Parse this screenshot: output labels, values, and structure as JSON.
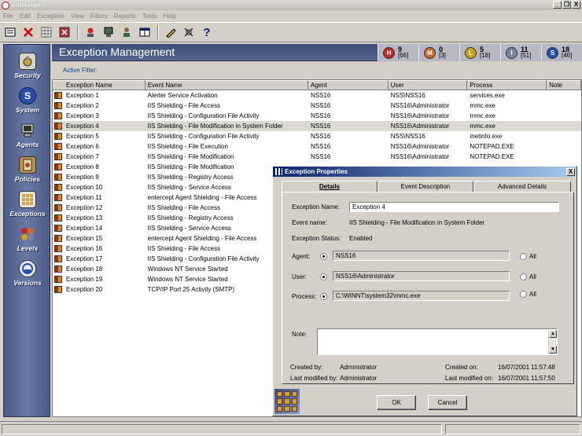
{
  "app": {
    "title": "entercept"
  },
  "menu": [
    "File",
    "Edit",
    "Exception",
    "View",
    "Filters",
    "Reports",
    "Tools",
    "Help"
  ],
  "toolbar": {
    "icons": [
      "properties-icon",
      "delete-icon",
      "grid-icon",
      "filter-icon",
      "agent-icon",
      "report-icon",
      "user-icon",
      "window-icon",
      "edit-icon",
      "clear-icon",
      "help-icon"
    ],
    "help_glyph": "?"
  },
  "sidebar": {
    "items": [
      {
        "label": "Security",
        "icon": "security-icon"
      },
      {
        "label": "System",
        "icon": "system-icon"
      },
      {
        "label": "Agents",
        "icon": "agents-icon"
      },
      {
        "label": "Policies",
        "icon": "policies-icon"
      },
      {
        "label": "Exceptions",
        "icon": "exceptions-icon"
      },
      {
        "label": "Levels",
        "icon": "levels-icon"
      },
      {
        "label": "Versions",
        "icon": "versions-icon"
      }
    ]
  },
  "header": {
    "title": "Exception Management",
    "counts": [
      {
        "letter": "H",
        "value": "9",
        "total": "[66]",
        "color": "#c0282a"
      },
      {
        "letter": "M",
        "value": "0",
        "total": "[3]",
        "color": "#c86a2a"
      },
      {
        "letter": "L",
        "value": "5",
        "total": "[18]",
        "color": "#c8a020"
      },
      {
        "letter": "I",
        "value": "11",
        "total": "[51]",
        "color": "#7a80a8"
      },
      {
        "letter": "S",
        "value": "18",
        "total": "[46]",
        "color": "#2a4ea8"
      }
    ]
  },
  "filter": {
    "label": "Active Filter:"
  },
  "table": {
    "columns": [
      "Exception Name",
      "Event Name",
      "Agent",
      "User",
      "Process",
      "Note"
    ],
    "rows": [
      [
        "Exception 1",
        "Alerter Service Activation",
        "NSS16",
        "NSS\\NSS16",
        "services.exe",
        ""
      ],
      [
        "Exception 2",
        "IIS Shielding - File Access",
        "NSS16",
        "NSS16\\Administrator",
        "mmc.exe",
        ""
      ],
      [
        "Exception 3",
        "IIS Shielding - Configuration File Activity",
        "NSS16",
        "NSS16\\Administrator",
        "mmc.exe",
        ""
      ],
      [
        "Exception 4",
        "IIS Shielding - File Modification in System Folder",
        "NSS16",
        "NSS16\\Administrator",
        "mmc.exe",
        ""
      ],
      [
        "Exception 5",
        "IIS Shielding - Configuration File Activity",
        "NSS16",
        "NSS\\NSS16",
        "inetinfo.exe",
        ""
      ],
      [
        "Exception 6",
        "IIS Shielding - File Execution",
        "NSS16",
        "NSS16\\Administrator",
        "NOTEPAD.EXE",
        ""
      ],
      [
        "Exception 7",
        "IIS Shielding - File Modification",
        "NSS16",
        "NSS16\\Administrator",
        "NOTEPAD.EXE",
        ""
      ],
      [
        "Exception 8",
        "IIS Shielding - File Modification",
        "",
        "",
        "",
        ""
      ],
      [
        "Exception 9",
        "IIS Shielding - Registry Access",
        "",
        "",
        "",
        ""
      ],
      [
        "Exception 10",
        "IIS Shielding - Service Access",
        "",
        "",
        "",
        ""
      ],
      [
        "Exception 11",
        "entercept Agent Shielding - File Access",
        "",
        "",
        "",
        ""
      ],
      [
        "Exception 12",
        "IIS Shielding - File Access",
        "",
        "",
        "",
        ""
      ],
      [
        "Exception 13",
        "IIS Shielding - Registry Access",
        "",
        "",
        "",
        ""
      ],
      [
        "Exception 14",
        "IIS Shielding - Service Access",
        "",
        "",
        "",
        ""
      ],
      [
        "Exception 15",
        "entercept Agent Shielding - File Access",
        "",
        "",
        "",
        ""
      ],
      [
        "Exception 16",
        "IIS Shielding - File Access",
        "",
        "",
        "",
        ""
      ],
      [
        "Exception 17",
        "IIS Shielding - Configuration File Activity",
        "",
        "",
        "",
        ""
      ],
      [
        "Exception 18",
        "Windows NT Service Started",
        "",
        "",
        "",
        ""
      ],
      [
        "Exception 19",
        "Windows NT Service Started",
        "",
        "",
        "",
        ""
      ],
      [
        "Exception 20",
        "TCP/IP Port 25 Activity (SMTP)",
        "",
        "",
        "",
        ""
      ]
    ],
    "selected_index": 3
  },
  "dialog": {
    "title": "Exception Properties",
    "close": "X",
    "tabs": [
      "Details",
      "Event Description",
      "Advanced Details"
    ],
    "exception_name_label": "Exception Name:",
    "exception_name_value": "Exception 4",
    "event_name_label": "Event name:",
    "event_name_value": "IIS Shielding - File Modification in System Folder",
    "status_label": "Exception Status:",
    "status_value": "Enabled",
    "agent_label": "Agent:",
    "agent_value": "NSS16",
    "user_label": "User:",
    "user_value": "NSS16\\Administrator",
    "process_label": "Process:",
    "process_value": "C:\\WINNT\\system32\\mmc.exe",
    "all_label": "All",
    "note_label": "Note:",
    "created_by_label": "Created by:",
    "created_by_value": "Administrator",
    "modified_by_label": "Last modified by:",
    "modified_by_value": "Administrator",
    "created_on_label": "Created on:",
    "created_on_value": "16/07/2001 11:57:48",
    "modified_on_label": "Last modified on:",
    "modified_on_value": "16/07/2001 11:57:50",
    "ok_label": "OK",
    "cancel_label": "Cancel"
  },
  "window_buttons": {
    "minimize": "_",
    "restore": "❐",
    "close": "X"
  }
}
